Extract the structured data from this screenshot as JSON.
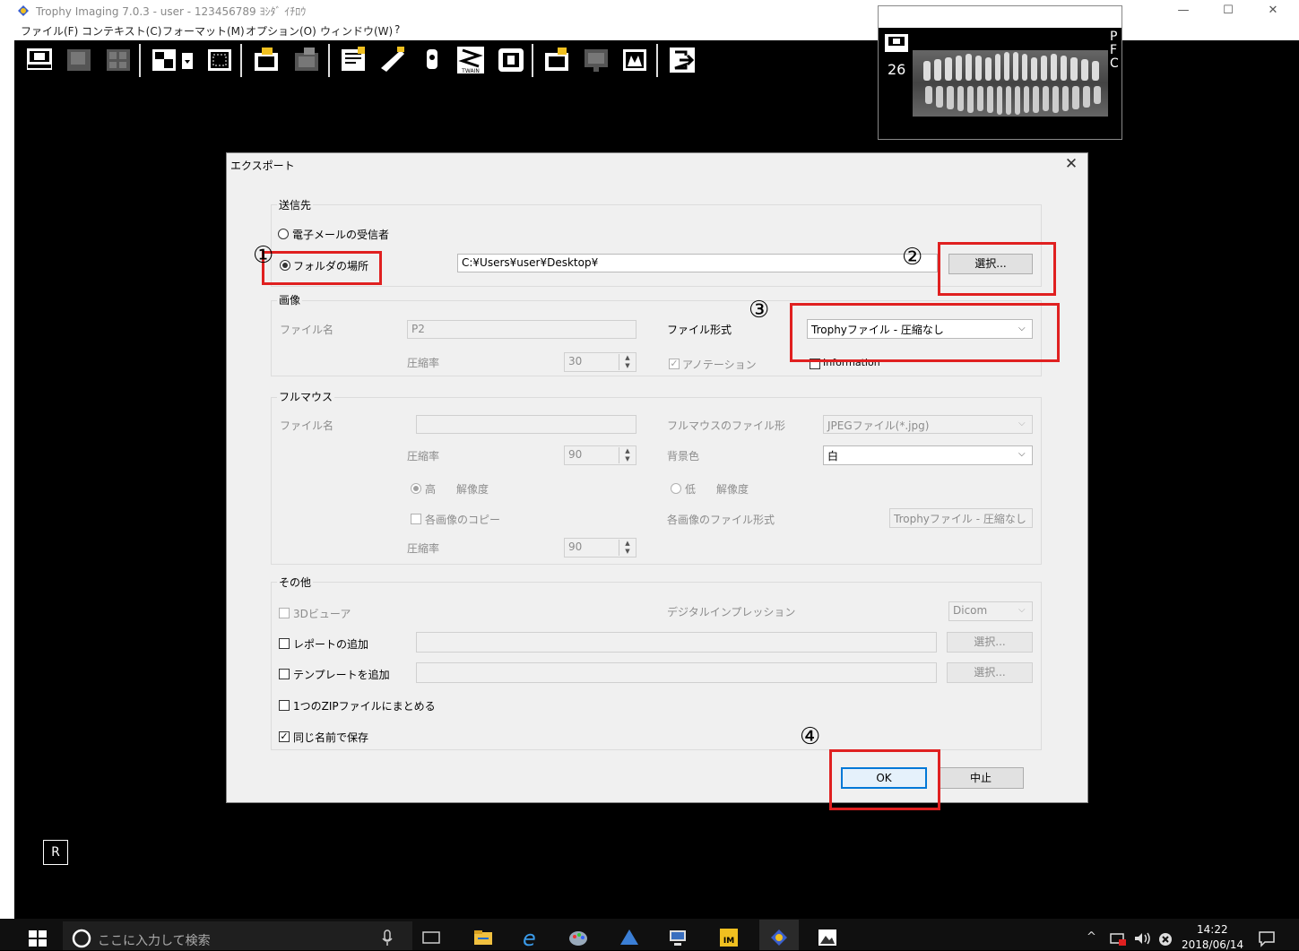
{
  "app": {
    "title": "Trophy Imaging 7.0.3 - user - 123456789 ﾖｼﾀﾞ ｲﾁﾛｳ",
    "window_controls": [
      "—",
      "☐",
      "✕"
    ]
  },
  "menu": [
    "ファイル(F)",
    "コンテキスト(C)",
    "フォーマット(M)",
    "オプション(O)",
    "ウィンドウ(W)",
    "?"
  ],
  "thumbnail": {
    "number": "26",
    "letters": [
      "P",
      "F",
      "C"
    ]
  },
  "dialog": {
    "title": "エクスポート",
    "close": "✕",
    "destination": {
      "group_label": "送信先",
      "email_option": "電子メールの受信者",
      "folder_option": "フォルダの場所",
      "path_value": "C:¥Users¥user¥Desktop¥",
      "select_button": "選択..."
    },
    "image": {
      "group_label": "画像",
      "filename_label": "ファイル名",
      "filename_value": "P2",
      "format_label": "ファイル形式",
      "format_value": "Trophyファイル - 圧縮なし",
      "compression_label": "圧縮率",
      "compression_value": "30",
      "annotation_label": "アノテーション",
      "information_label": "Information"
    },
    "fullmouth": {
      "group_label": "フルマウス",
      "filename_label": "ファイル名",
      "filename_value": "",
      "format_label": "フルマウスのファイル形",
      "format_value": "JPEGファイル(*.jpg)",
      "compression_label": "圧縮率",
      "compression_value": "90",
      "bg_label": "背景色",
      "bg_value": "白",
      "high_label": "高",
      "low_label": "低",
      "resolution_label": "解像度",
      "copy_label": "各画像のコピー",
      "each_format_label": "各画像のファイル形式",
      "each_format_value": "Trophyファイル - 圧縮なし",
      "compression2_label": "圧縮率",
      "compression2_value": "90"
    },
    "other": {
      "group_label": "その他",
      "viewer3d_label": "3Dビューア",
      "digital_label": "デジタルインプレッション",
      "digital_value": "Dicom",
      "add_report_label": "レポートの追加",
      "add_template_label": "テンプレートを追加",
      "select_button": "選択...",
      "zip_label": "1つのZIPファイルにまとめる",
      "same_name_label": "同じ名前で保存"
    },
    "ok_button": "OK",
    "cancel_button": "中止"
  },
  "markers": [
    "①",
    "②",
    "③",
    "④"
  ],
  "r_box": "R",
  "taskbar": {
    "search_placeholder": "ここに入力して検索",
    "time": "14:22",
    "date": "2018/06/14"
  },
  "colors": {
    "highlight": "#e02020",
    "focus": "#0078d7"
  }
}
